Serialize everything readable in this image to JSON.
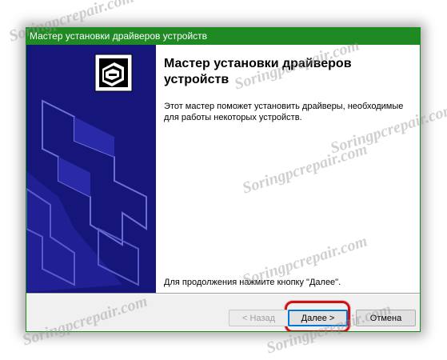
{
  "window": {
    "title": "Мастер установки драйверов устройств"
  },
  "content": {
    "heading": "Мастер установки драйверов устройств",
    "description": "Этот мастер поможет установить драйверы, необходимые для работы некоторых устройств.",
    "hint": "Для продолжения нажмите кнопку \"Далее\"."
  },
  "buttons": {
    "back": "< Назад",
    "next": "Далее >",
    "cancel": "Отмена"
  },
  "watermark": "Soringpcrepair.com",
  "colors": {
    "titlebar": "#1f8a23",
    "side_panel": "#16167a",
    "highlight": "#d11010"
  }
}
